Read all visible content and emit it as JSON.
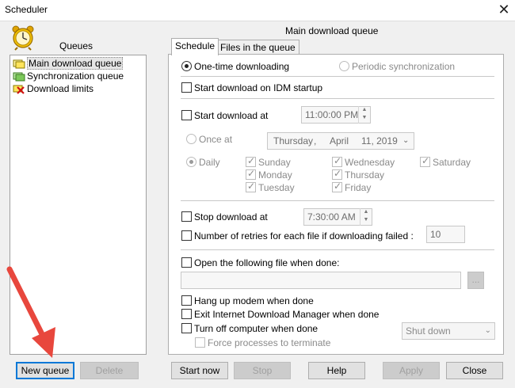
{
  "window": {
    "title": "Scheduler",
    "close_glyph": "✕"
  },
  "sidebar": {
    "header": "Queues",
    "items": [
      {
        "label": "Main download queue",
        "icon": "queue-folder-icon"
      },
      {
        "label": "Synchronization queue",
        "icon": "sync-queue-icon"
      },
      {
        "label": "Download limits",
        "icon": "download-limits-icon"
      }
    ],
    "new_queue": "New queue",
    "delete": "Delete"
  },
  "main": {
    "title": "Main download queue",
    "tabs": [
      "Schedule",
      "Files in the queue"
    ]
  },
  "schedule": {
    "one_time": "One-time downloading",
    "periodic": "Periodic synchronization",
    "start_on_startup": "Start download on IDM startup",
    "start_at": "Start download at",
    "start_time": "11:00:00 PM",
    "once_at": "Once at",
    "date_day": "Thursday",
    "date_sep": ",",
    "date_month": "April",
    "date_rest": "11, 2019",
    "daily": "Daily",
    "days": {
      "sunday": "Sunday",
      "monday": "Monday",
      "tuesday": "Tuesday",
      "wednesday": "Wednesday",
      "thursday": "Thursday",
      "friday": "Friday",
      "saturday": "Saturday"
    },
    "stop_at": "Stop download at",
    "stop_time": "7:30:00 AM",
    "retries": "Number of retries for each file if downloading failed :",
    "retries_value": "10",
    "open_file": "Open the following file when done:",
    "open_file_value": "",
    "browse": "...",
    "hang_up": "Hang up modem when done",
    "exit_idm": "Exit Internet Download Manager when done",
    "turn_off": "Turn off computer when done",
    "shutdown_option": "Shut down",
    "force": "Force processes to terminate"
  },
  "footer": {
    "start_now": "Start now",
    "stop": "Stop",
    "help": "Help",
    "apply": "Apply",
    "close": "Close"
  },
  "colors": {
    "annotation_arrow": "#e8473d"
  }
}
